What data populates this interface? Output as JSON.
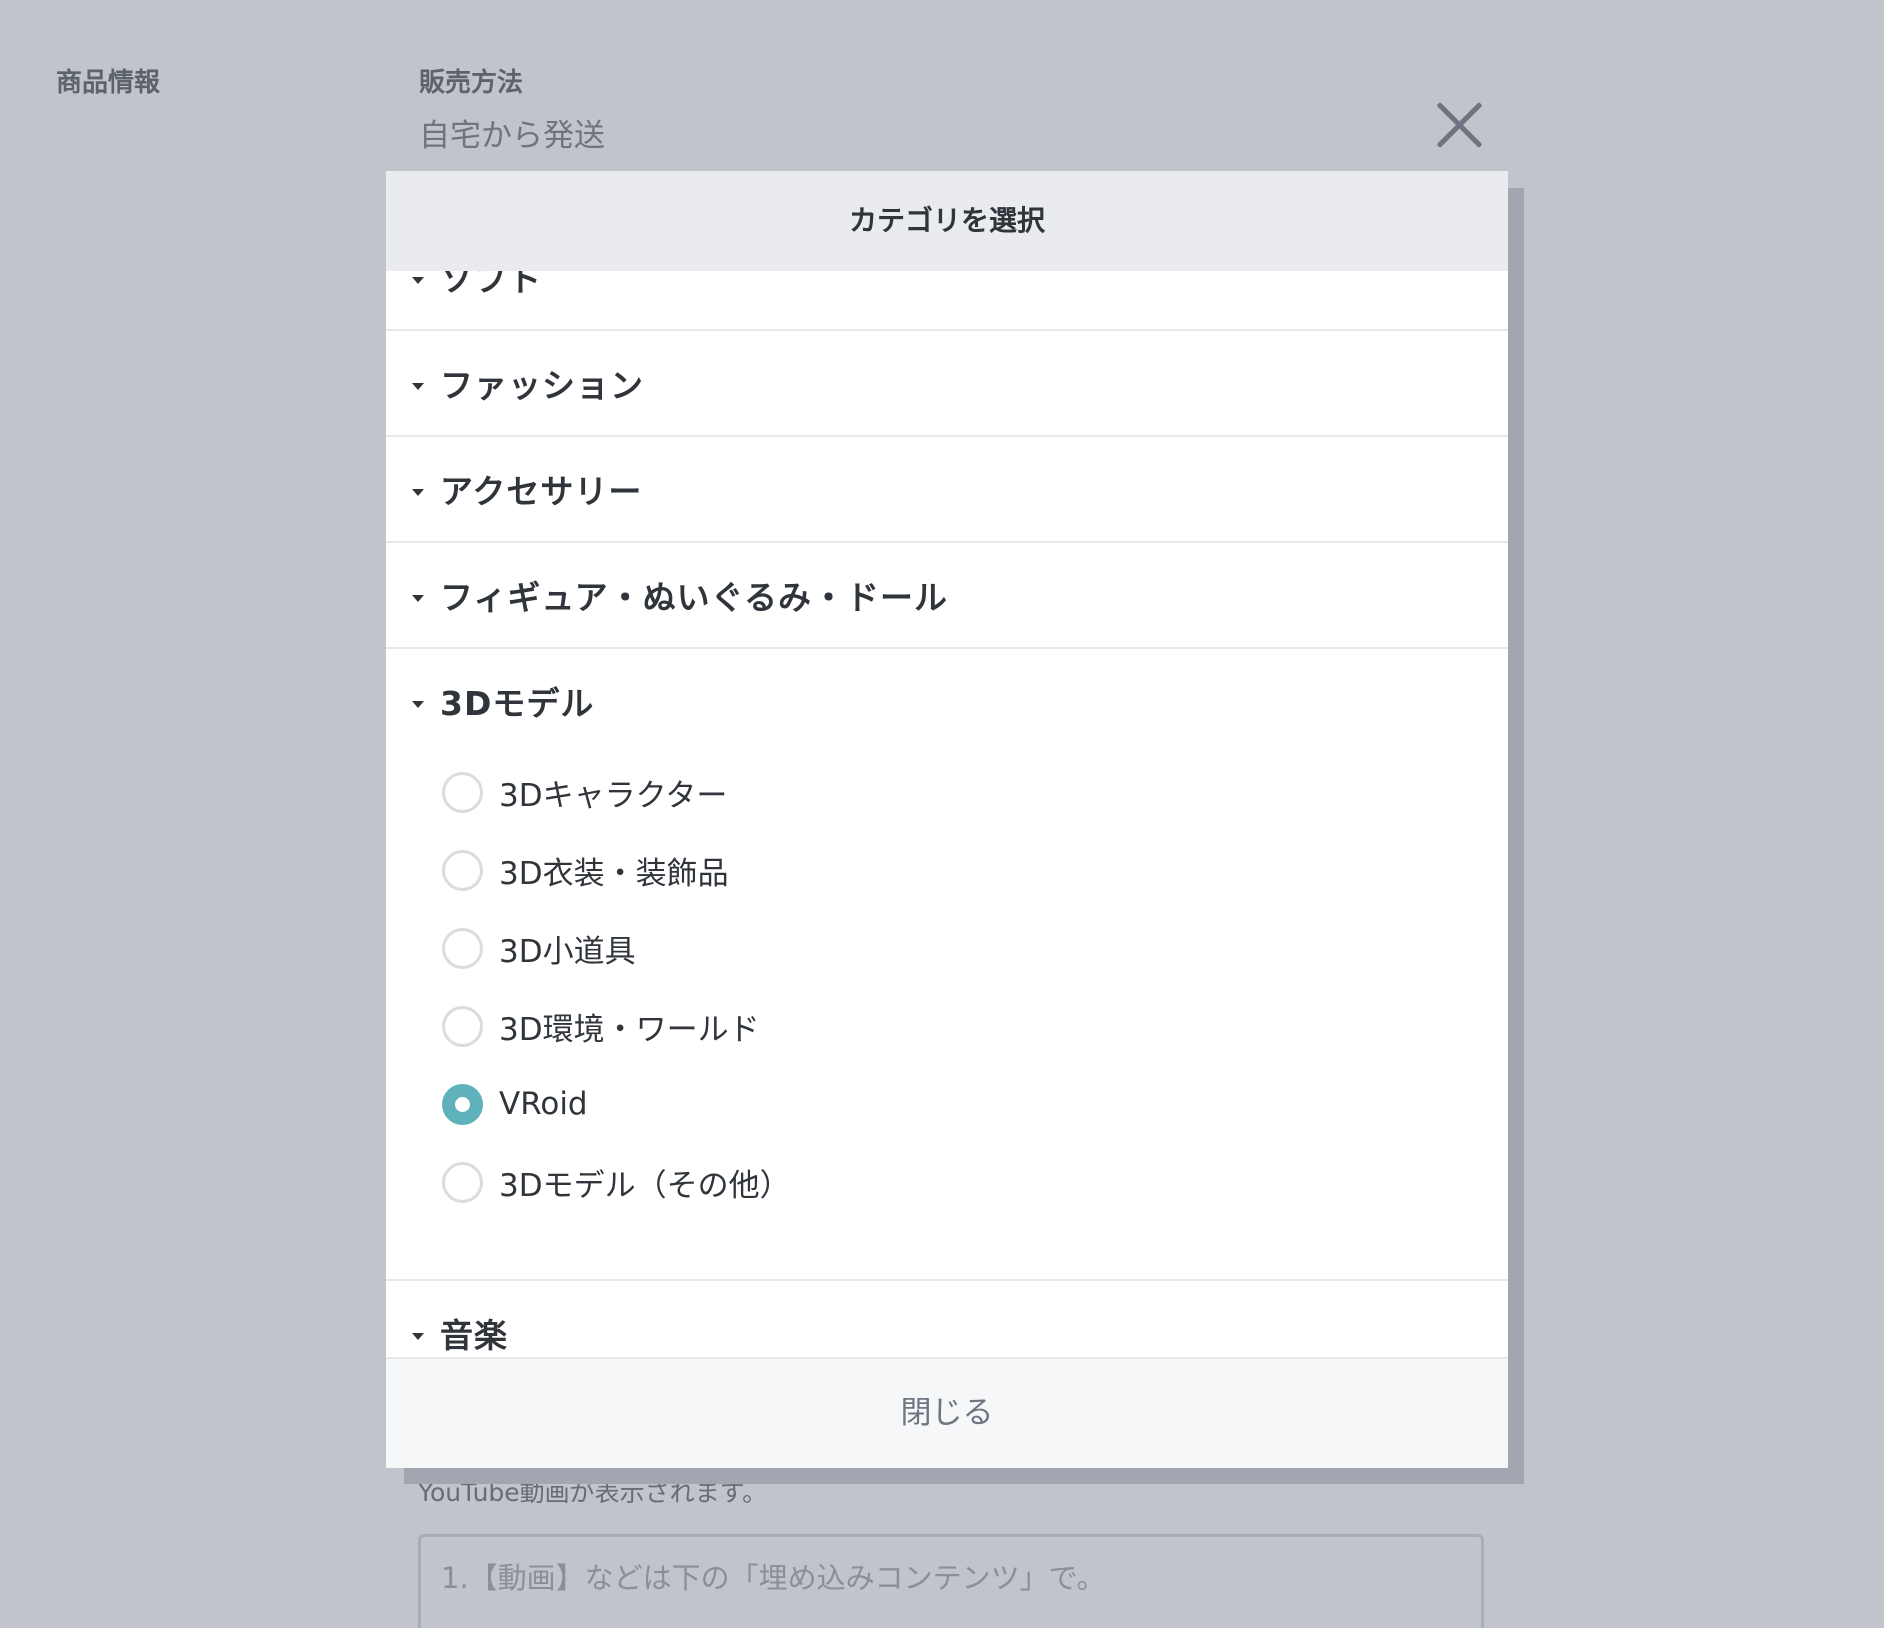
{
  "background": {
    "section_title": "商品情報",
    "sales_method_label": "販売方法",
    "sales_method_value": "自宅から発送",
    "youtube_note": "YouTube動画が表示されます。",
    "textarea_placeholder": "1.【動画】などは下の「埋め込みコンテンツ」で。"
  },
  "modal": {
    "title": "カテゴリを選択",
    "close_label": "閉じる",
    "close_icon": "close-icon",
    "categories": [
      {
        "label": "ソフト"
      },
      {
        "label": "ファッション"
      },
      {
        "label": "アクセサリー"
      },
      {
        "label": "フィギュア・ぬいぐるみ・ドール"
      },
      {
        "label": "3Dモデル",
        "options": [
          {
            "label": "3Dキャラクター",
            "checked": false
          },
          {
            "label": "3D衣装・装飾品",
            "checked": false
          },
          {
            "label": "3D小道具",
            "checked": false
          },
          {
            "label": "3D環境・ワールド",
            "checked": false
          },
          {
            "label": "VRoid",
            "checked": true
          },
          {
            "label": "3Dモデル（その他）",
            "checked": false
          }
        ]
      },
      {
        "label": "音楽"
      }
    ]
  },
  "colors": {
    "accent_radio": "#5fb2bb",
    "overlay": "#767c8a",
    "header_bg": "#e9ebef"
  }
}
